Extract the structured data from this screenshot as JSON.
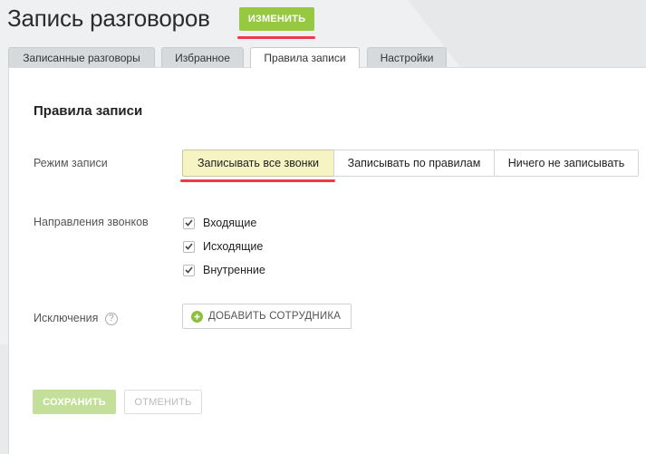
{
  "header": {
    "title": "Запись разговоров",
    "edit_label": "ИЗМЕНИТЬ"
  },
  "tabs": [
    {
      "label": "Записанные разговоры",
      "active": false
    },
    {
      "label": "Избранное",
      "active": false
    },
    {
      "label": "Правила записи",
      "active": true
    },
    {
      "label": "Настройки",
      "active": false
    }
  ],
  "content": {
    "section_title": "Правила записи",
    "mode": {
      "label": "Режим записи",
      "options": [
        "Записывать все звонки",
        "Записывать по правилам",
        "Ничего не записывать"
      ],
      "selected": "Записывать все звонки"
    },
    "directions": {
      "label": "Направления звонков",
      "items": [
        {
          "label": "Входящие",
          "checked": true
        },
        {
          "label": "Исходящие",
          "checked": true
        },
        {
          "label": "Внутренние",
          "checked": true
        }
      ]
    },
    "exclusions": {
      "label": "Исключения",
      "help_glyph": "?",
      "add_label": "ДОБАВИТЬ СОТРУДНИКА"
    },
    "actions": {
      "save_label": "СОХРАНИТЬ",
      "cancel_label": "ОТМЕНИТЬ"
    }
  },
  "colors": {
    "accent_green": "#96c842",
    "highlight_red": "#f0384c",
    "selected_option_bg": "#f6f4c2"
  },
  "icons": {
    "checkbox": "check-icon",
    "help": "question-circle-icon",
    "add": "plus-circle-icon"
  }
}
